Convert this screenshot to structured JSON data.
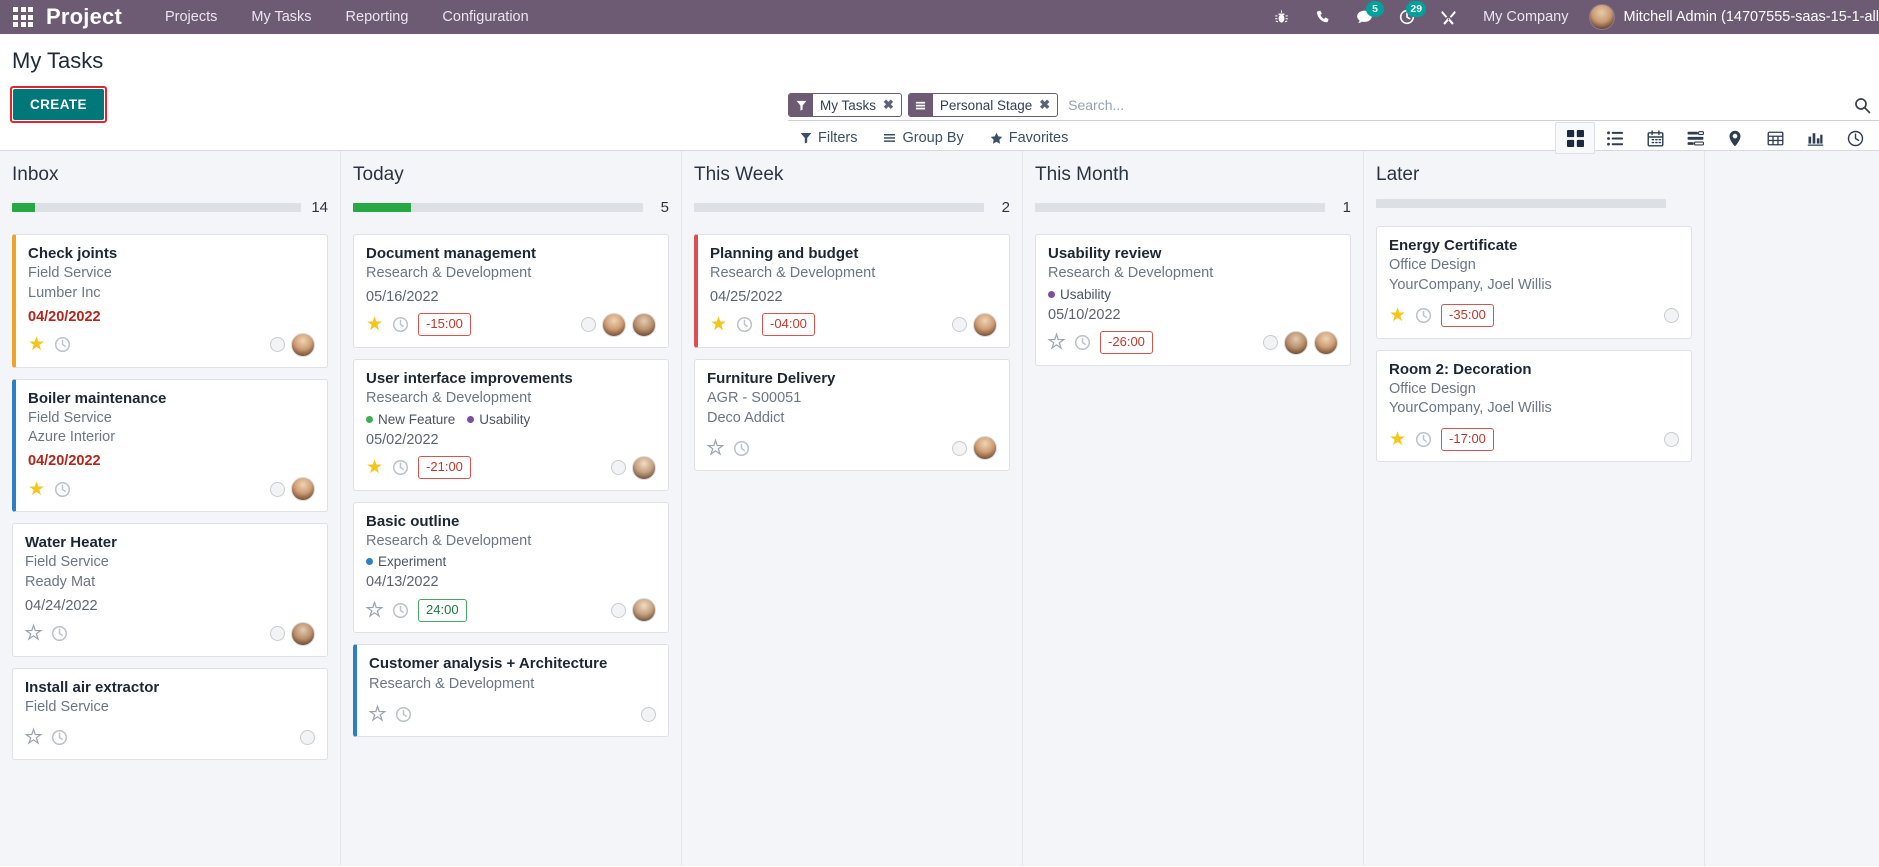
{
  "navbar": {
    "brand": "Project",
    "menu": [
      "Projects",
      "My Tasks",
      "Reporting",
      "Configuration"
    ],
    "icons": [
      {
        "name": "bug-icon",
        "badge": null
      },
      {
        "name": "phone-icon",
        "badge": null
      },
      {
        "name": "messages-icon",
        "badge": "5"
      },
      {
        "name": "activities-clock-icon",
        "badge": "29"
      },
      {
        "name": "tools-icon",
        "badge": null
      }
    ],
    "company": "My Company",
    "user": "Mitchell Admin (14707555-saas-15-1-all"
  },
  "control_panel": {
    "title": "My Tasks",
    "create_label": "CREATE",
    "search": {
      "placeholder": "Search...",
      "facets": [
        {
          "icon": "filter-funnel-icon",
          "label": "My Tasks",
          "close": "✖"
        },
        {
          "icon": "group-by-bars-icon",
          "label": "Personal Stage",
          "close": "✖"
        }
      ]
    },
    "dropdowns": [
      {
        "name": "filters",
        "label": "Filters",
        "icon": "funnel-icon"
      },
      {
        "name": "group-by",
        "label": "Group By",
        "icon": "bars-icon"
      },
      {
        "name": "favorites",
        "label": "Favorites",
        "icon": "star-icon"
      }
    ],
    "views": [
      {
        "name": "kanban",
        "active": true
      },
      {
        "name": "list",
        "active": false
      },
      {
        "name": "calendar",
        "active": false
      },
      {
        "name": "gantt",
        "active": false
      },
      {
        "name": "map",
        "active": false
      },
      {
        "name": "pivot",
        "active": false
      },
      {
        "name": "graph",
        "active": false
      },
      {
        "name": "activity",
        "active": false
      }
    ]
  },
  "colors": {
    "navbar": "#6d5b74",
    "create_button": "#00787a",
    "highlight_outline": "#e8232c",
    "progress_green": "#28a745",
    "overdue_red": "#b3241c",
    "badge_teal": "#00a09d"
  },
  "kanban": {
    "columns": [
      {
        "title": "Inbox",
        "count": "14",
        "progress_pct": 8,
        "cards": [
          {
            "title": "Check joints",
            "project": "Field Service",
            "partner": "Lumber Inc",
            "tags": [],
            "date": "04/20/2022",
            "overdue": true,
            "stripe": "orange",
            "star": "full",
            "time_badge": null,
            "avatars": [
              "a1"
            ]
          },
          {
            "title": "Boiler maintenance",
            "project": "Field Service",
            "partner": "Azure Interior",
            "tags": [],
            "date": "04/20/2022",
            "overdue": true,
            "stripe": "blue",
            "star": "full",
            "time_badge": null,
            "avatars": [
              "a1"
            ]
          },
          {
            "title": "Water Heater",
            "project": "Field Service",
            "partner": "Ready Mat",
            "tags": [],
            "date": "04/24/2022",
            "overdue": false,
            "stripe": "none",
            "star": "empty",
            "time_badge": null,
            "avatars": [
              "a2"
            ]
          },
          {
            "title": "Install air extractor",
            "project": "Field Service",
            "partner": "",
            "tags": [],
            "date": "",
            "overdue": false,
            "stripe": "none",
            "star": "empty",
            "time_badge": null,
            "avatars": []
          }
        ]
      },
      {
        "title": "Today",
        "count": "5",
        "progress_pct": 20,
        "cards": [
          {
            "title": "Document management",
            "project": "Research & Development",
            "partner": "",
            "tags": [],
            "date": "05/16/2022",
            "overdue": false,
            "stripe": "none",
            "star": "full",
            "time_badge": {
              "text": "-15:00",
              "kind": "neg"
            },
            "avatars": [
              "a1",
              "a2"
            ]
          },
          {
            "title": "User interface improvements",
            "project": "Research & Development",
            "partner": "",
            "tags": [
              {
                "label": "New Feature",
                "color": "#3eb04f"
              },
              {
                "label": "Usability",
                "color": "#7b4f9e"
              }
            ],
            "date": "05/02/2022",
            "overdue": false,
            "stripe": "none",
            "star": "full",
            "time_badge": {
              "text": "-21:00",
              "kind": "neg"
            },
            "avatars": [
              "a3"
            ]
          },
          {
            "title": "Basic outline",
            "project": "Research & Development",
            "partner": "",
            "tags": [
              {
                "label": "Experiment",
                "color": "#2b7fc4"
              }
            ],
            "date": "04/13/2022",
            "overdue": false,
            "stripe": "none",
            "star": "empty",
            "time_badge": {
              "text": "24:00",
              "kind": "pos"
            },
            "avatars": [
              "a3"
            ]
          },
          {
            "title": "Customer analysis + Architecture",
            "project": "Research & Development",
            "partner": "",
            "tags": [],
            "date": "",
            "overdue": false,
            "stripe": "blue",
            "star": "empty",
            "time_badge": null,
            "avatars": []
          }
        ]
      },
      {
        "title": "This Week",
        "count": "2",
        "progress_pct": 0,
        "cards": [
          {
            "title": "Planning and budget",
            "project": "Research & Development",
            "partner": "",
            "tags": [],
            "date": "04/25/2022",
            "overdue": false,
            "stripe": "red",
            "star": "full",
            "time_badge": {
              "text": "-04:00",
              "kind": "neg"
            },
            "avatars": [
              "a1"
            ]
          },
          {
            "title": "Furniture Delivery",
            "project": "AGR - S00051",
            "partner": "Deco Addict",
            "tags": [],
            "date": "",
            "overdue": false,
            "stripe": "none",
            "star": "empty",
            "time_badge": null,
            "avatars": [
              "a1"
            ]
          }
        ]
      },
      {
        "title": "This Month",
        "count": "1",
        "progress_pct": 0,
        "cards": [
          {
            "title": "Usability review",
            "project": "Research & Development",
            "partner": "",
            "tags": [
              {
                "label": "Usability",
                "color": "#7b4f9e"
              }
            ],
            "date": "05/10/2022",
            "overdue": false,
            "stripe": "none",
            "star": "empty",
            "time_badge": {
              "text": "-26:00",
              "kind": "neg"
            },
            "avatars": [
              "a2",
              "a1"
            ]
          }
        ]
      },
      {
        "title": "Later",
        "count": "",
        "progress_pct": 0,
        "cards": [
          {
            "title": "Energy Certificate",
            "project": "Office Design",
            "partner": "YourCompany, Joel Willis",
            "tags": [],
            "date": "",
            "overdue": false,
            "stripe": "none",
            "star": "full",
            "time_badge": {
              "text": "-35:00",
              "kind": "neg"
            },
            "avatars": []
          },
          {
            "title": "Room 2: Decoration",
            "project": "Office Design",
            "partner": "YourCompany, Joel Willis",
            "tags": [],
            "date": "",
            "overdue": false,
            "stripe": "none",
            "star": "full",
            "time_badge": {
              "text": "-17:00",
              "kind": "neg"
            },
            "avatars": []
          }
        ]
      }
    ]
  }
}
